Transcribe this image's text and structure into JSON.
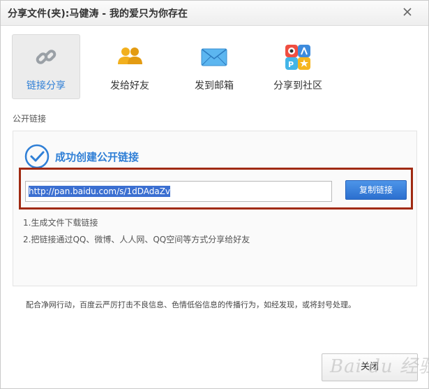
{
  "window": {
    "title": "分享文件(夹):马健涛 - 我的爱只为你存在"
  },
  "tabs": [
    {
      "label": "链接分享",
      "icon": "link-icon",
      "active": true
    },
    {
      "label": "发给好友",
      "icon": "friends-icon",
      "active": false
    },
    {
      "label": "发到邮箱",
      "icon": "envelope-icon",
      "active": false
    },
    {
      "label": "分享到社区",
      "icon": "community-icon",
      "active": false
    }
  ],
  "section": {
    "label": "公开链接"
  },
  "link_panel": {
    "success_text": "成功创建公开链接",
    "url": "http://pan.baidu.com/s/1dDAdaZv",
    "copy_label": "复制链接",
    "tips": [
      "1.生成文件下载链接",
      "2.把链接通过QQ、微博、人人网、QQ空间等方式分享给好友"
    ]
  },
  "notice": "配合净网行动，百度云严厉打击不良信息、色情低俗信息的传播行为，如经发现，或将封号处理。",
  "footer": {
    "close_label": "关闭",
    "watermark": "Bai du 经验"
  },
  "colors": {
    "accent": "#2f7fd6",
    "highlight_border": "#a02a12",
    "copy_button": "#2b6fcf"
  }
}
